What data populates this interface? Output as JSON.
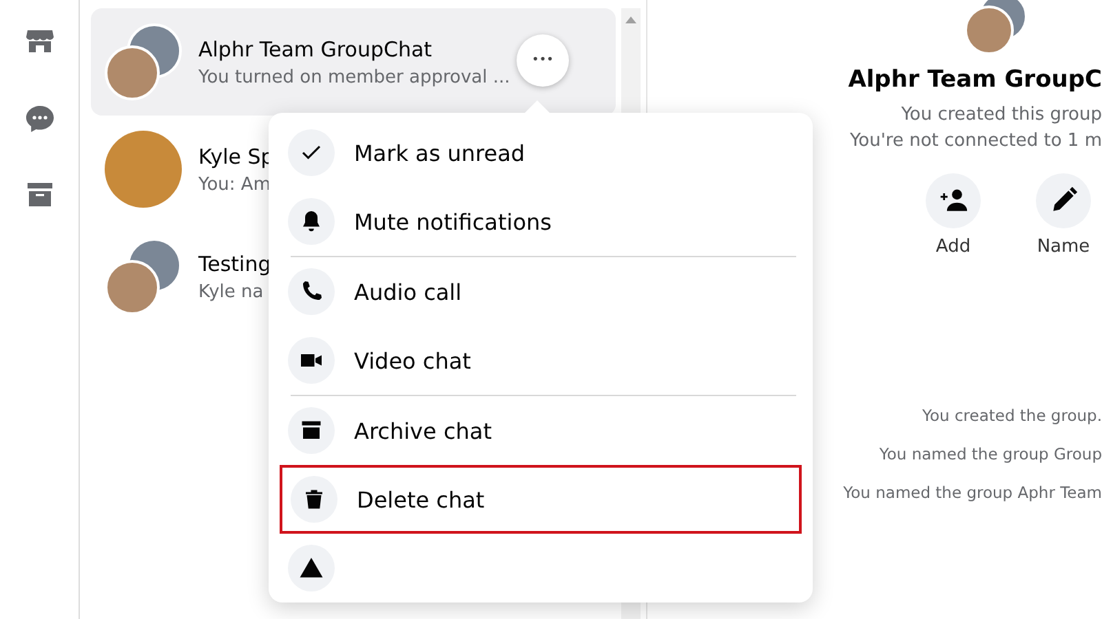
{
  "rail": [
    {
      "kind": "store"
    },
    {
      "kind": "chat"
    },
    {
      "kind": "archive"
    }
  ],
  "chats": [
    {
      "name": "Alphr Team GroupChat",
      "preview": "You turned on member approval ...",
      "group": true,
      "selected": true
    },
    {
      "name": "Kyle Sp",
      "preview": "You: Am",
      "group": false,
      "selected": false
    },
    {
      "name": "Testing",
      "preview": "Kyle na",
      "group": true,
      "selected": false
    }
  ],
  "more_button": {
    "label": "•••"
  },
  "menu": {
    "groups": [
      {
        "items": [
          {
            "label": "Mark as unread",
            "kind": "check",
            "highlighted": false
          },
          {
            "label": "Mute notifications",
            "kind": "bell",
            "highlighted": false
          }
        ]
      },
      {
        "items": [
          {
            "label": "Audio call",
            "kind": "phone",
            "highlighted": false
          },
          {
            "label": "Video chat",
            "kind": "video",
            "highlighted": false
          }
        ]
      },
      {
        "items": [
          {
            "label": "Archive chat",
            "kind": "archive",
            "highlighted": false
          },
          {
            "label": "Delete chat",
            "kind": "trash",
            "highlighted": true
          }
        ]
      }
    ]
  },
  "details": {
    "title": "Alphr Team GroupC",
    "subtitle": "You created this group",
    "note": "You're not connected to 1 m",
    "actions": [
      {
        "label": "Add",
        "kind": "add-person"
      },
      {
        "label": "Name",
        "kind": "pencil"
      }
    ],
    "events": [
      "You created the group.",
      "You named the group Group",
      "You named the group Aphr Team"
    ]
  }
}
